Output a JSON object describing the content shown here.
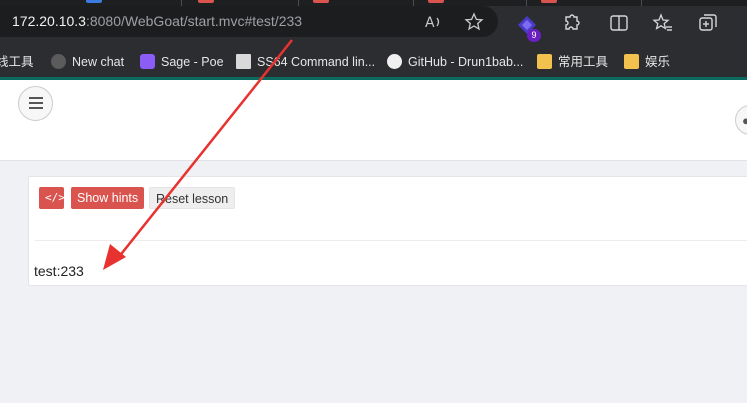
{
  "browser": {
    "url_host": "172.20.10.3",
    "url_path": ":8080/WebGoat/start.mvc#test/233",
    "extension_badge": "9",
    "icons": [
      "read-aloud-icon",
      "favorite-star-icon",
      "extension-icon",
      "puzzle-icon",
      "split-screen-icon",
      "favorites-icon",
      "collections-icon"
    ]
  },
  "bookmarks": [
    {
      "label": "线工具",
      "icon": "tools-icon",
      "color": "#000000"
    },
    {
      "label": "New chat",
      "icon": "openai-icon",
      "color": "#5b5b5b"
    },
    {
      "label": "Sage - Poe",
      "icon": "poe-icon",
      "color": "#8b5cf6"
    },
    {
      "label": "SS64 Command lin...",
      "icon": "page-icon",
      "color": "#d9d9d9"
    },
    {
      "label": "GitHub - Drun1bab...",
      "icon": "github-icon",
      "color": "#f0f0f0"
    },
    {
      "label": "常用工具",
      "icon": "folder-icon",
      "color": "#f2c14e"
    },
    {
      "label": "娱乐",
      "icon": "folder-icon",
      "color": "#f2c14e"
    }
  ],
  "lesson": {
    "source_button": "</>",
    "hints_button": "Show hints",
    "reset_button": "Reset lesson",
    "output_text": "test:233"
  },
  "colors": {
    "danger": "#d9534f",
    "annotation_arrow": "#e8322f"
  }
}
